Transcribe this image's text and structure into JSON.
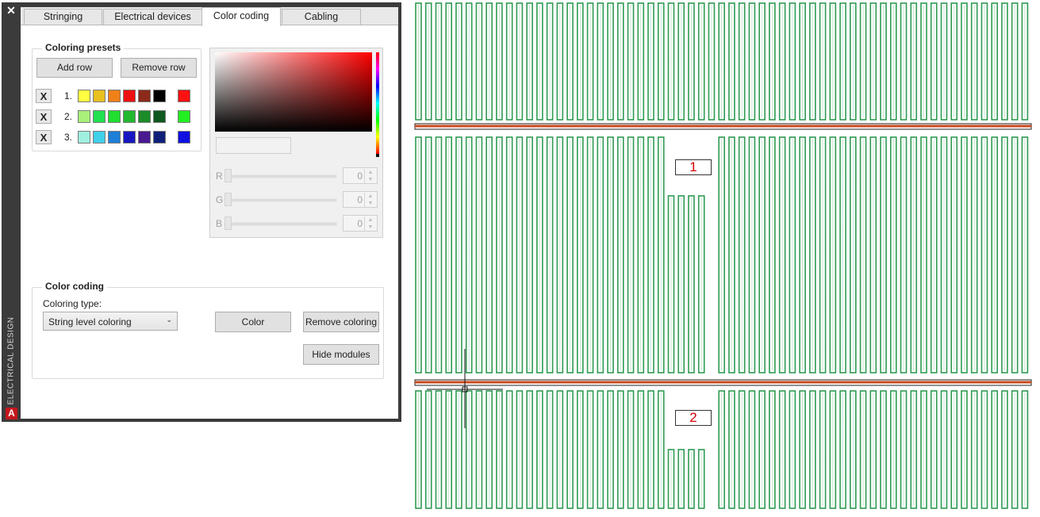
{
  "panel": {
    "side_title": "ELECTRICAL DESIGN",
    "close_glyph": "✕",
    "logo_letter": "A",
    "tabs": [
      {
        "label": "Stringing",
        "active": false
      },
      {
        "label": "Electrical devices",
        "active": false
      },
      {
        "label": "Color coding",
        "active": true
      },
      {
        "label": "Cabling",
        "active": false
      }
    ],
    "presets": {
      "title": "Coloring presets",
      "add_row": "Add row",
      "remove_row": "Remove row",
      "delete_glyph": "X",
      "rows": [
        {
          "number": "1.",
          "colors": [
            "#ffff40",
            "#e8c020",
            "#f08018",
            "#ee1111",
            "#8b2a1a",
            "#000000"
          ],
          "selected": "#ff1111"
        },
        {
          "number": "2.",
          "colors": [
            "#a8f07a",
            "#20e050",
            "#20dd30",
            "#22b830",
            "#1c8c28",
            "#105820"
          ],
          "selected": "#22ee22"
        },
        {
          "number": "3.",
          "colors": [
            "#a0f0e0",
            "#40d0e8",
            "#1e7fd8",
            "#1818c0",
            "#4a1a90",
            "#102078"
          ],
          "selected": "#1010e0"
        }
      ]
    },
    "picker": {
      "r_label": "R",
      "g_label": "G",
      "b_label": "B",
      "r_value": "0",
      "g_value": "0",
      "b_value": "0",
      "hue_color": "#ff0000"
    },
    "coding": {
      "title": "Color coding",
      "type_label": "Coloring type:",
      "type_value": "String level coloring",
      "color_button": "Color",
      "remove_button": "Remove coloring",
      "hide_button": "Hide modules"
    }
  },
  "drawing": {
    "labels": [
      "1",
      "2"
    ],
    "module_color": "#2e9b52",
    "cable_color": "#c84a20"
  }
}
